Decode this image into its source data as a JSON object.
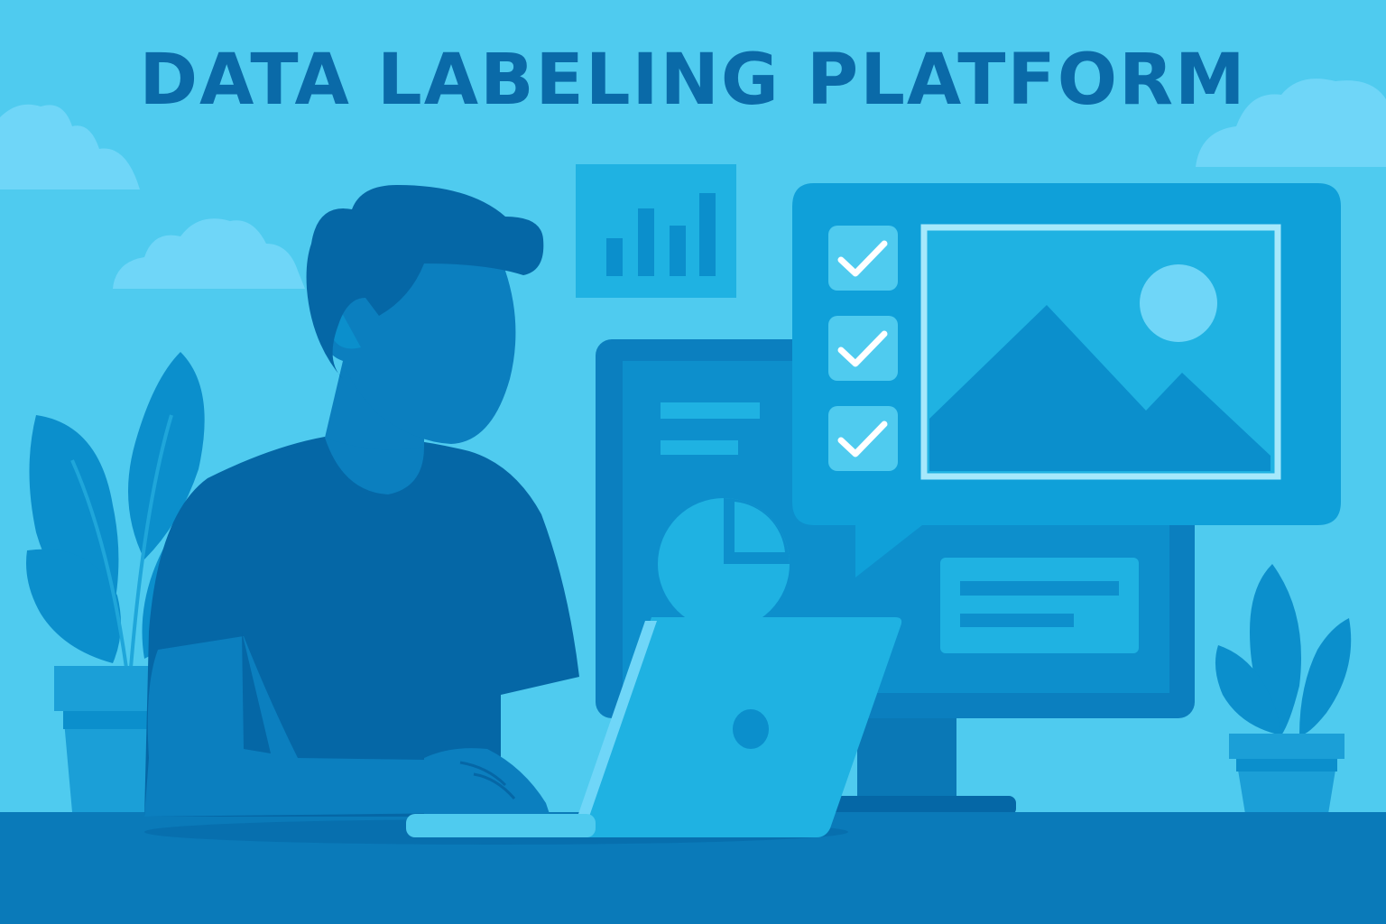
{
  "title": "DATA LABELING PLATFORM",
  "colors": {
    "background": "#4fcbef",
    "title": "#0a6aa8",
    "dark_blue": "#0567a6",
    "mid_blue": "#0b7fbf",
    "light_blue": "#1fb2e2",
    "pale_blue": "#6fd6f8",
    "desk": "#0a7ab9"
  },
  "icons": {
    "checklist": [
      "check-icon",
      "check-icon",
      "check-icon"
    ],
    "image_placeholder": "image-icon",
    "bar_chart": "bar-chart-icon",
    "pie_chart": "pie-chart-icon"
  }
}
